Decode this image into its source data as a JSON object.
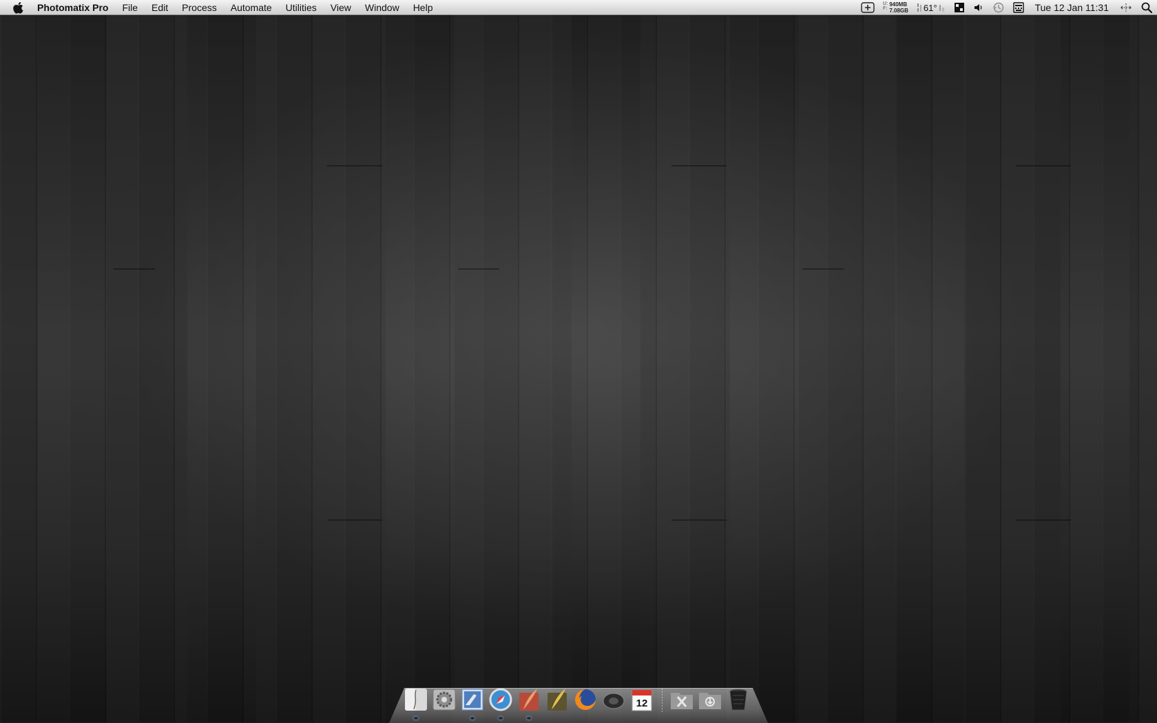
{
  "menubar": {
    "apple_icon": "apple-icon",
    "app_name": "Photomatix Pro",
    "menus": [
      "File",
      "Edit",
      "Process",
      "Automate",
      "Utilities",
      "View",
      "Window",
      "Help"
    ],
    "status": {
      "memory": {
        "used_label": "U:",
        "free_label": "F:",
        "used": "940MB",
        "free": "7.08GB"
      },
      "temperature": "61°",
      "clock": "Tue 12 Jan  11:31"
    }
  },
  "dock": {
    "apps": [
      {
        "icon": "finder-icon"
      },
      {
        "icon": "system-preferences-icon"
      },
      {
        "icon": "mail-icon"
      },
      {
        "icon": "safari-icon"
      },
      {
        "icon": "feather-app-icon"
      },
      {
        "icon": "quill-app-icon"
      },
      {
        "icon": "firefox-icon"
      },
      {
        "icon": "speaker-app-icon"
      },
      {
        "icon": "calendar-icon",
        "badge": "12"
      }
    ],
    "stacks": [
      {
        "icon": "applications-folder-icon"
      },
      {
        "icon": "downloads-folder-icon"
      },
      {
        "icon": "trash-icon"
      }
    ]
  }
}
